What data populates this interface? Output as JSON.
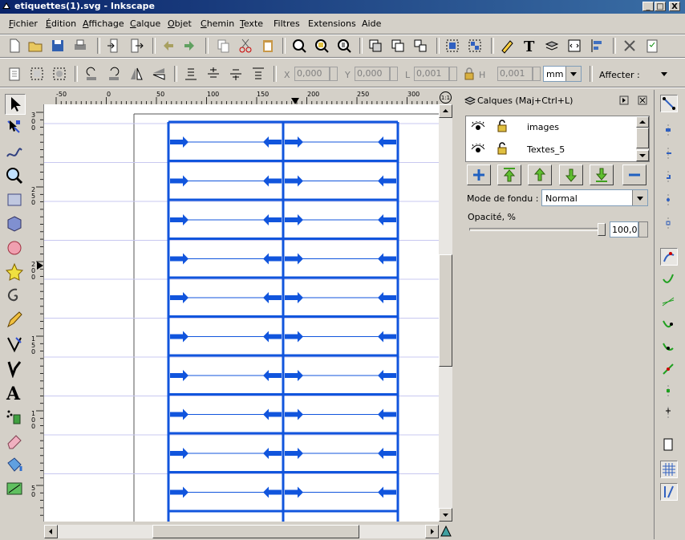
{
  "window": {
    "title": "etiquettes(1).svg - Inkscape",
    "minimize": "_",
    "maximize": "□",
    "close": "X"
  },
  "menu": [
    {
      "label": "Fichier",
      "u": "F",
      "rest": "ichier"
    },
    {
      "label": "Édition",
      "u": "É",
      "rest": "dition"
    },
    {
      "label": "Affichage",
      "u": "A",
      "rest": "ffichage"
    },
    {
      "label": "Calque",
      "u": "C",
      "rest": "alque"
    },
    {
      "label": "Objet",
      "u": "O",
      "rest": "bjet"
    },
    {
      "label": "Chemin",
      "u": "C",
      "rest": "hemin"
    },
    {
      "label": "Texte",
      "u": "T",
      "rest": "exte"
    },
    {
      "label": "Filtres",
      "u": "",
      "rest": "Filtres"
    },
    {
      "label": "Extensions",
      "u": "",
      "rest": "Extensions"
    },
    {
      "label": "Aide",
      "u": "",
      "rest": "Aide"
    }
  ],
  "controls": {
    "x_label": "X",
    "x_value": "0,000",
    "y_label": "Y",
    "y_value": "0,000",
    "w_label": "L",
    "w_value": "0,001",
    "h_label": "H",
    "h_value": "0,001",
    "unit": "mm",
    "affect_label": "Affecter :"
  },
  "ruler": {
    "h_ticks": [
      "-50",
      "0",
      "50",
      "100",
      "150",
      "200",
      "250",
      "300"
    ],
    "v_ticks": [
      "300",
      "250",
      "200",
      "150",
      "100",
      "50"
    ]
  },
  "zoom_badge": "1:1",
  "layers_panel": {
    "title": "Calques (Maj+Ctrl+L)",
    "layers": [
      {
        "name": "images"
      },
      {
        "name": "Textes_5"
      }
    ],
    "blend_label": "Mode de fondu :",
    "blend_value": "Normal",
    "opacity_label": "Opacité, %",
    "opacity_value": "100,0",
    "opacity_fraction": 1.0
  },
  "colors": {
    "title_bar_start": "#0a246a",
    "title_bar_end": "#3a6ea5",
    "label_blue": "#1155dd",
    "chrome": "#d4d0c8"
  },
  "labels_grid": {
    "rows": 10,
    "columns": 2
  }
}
